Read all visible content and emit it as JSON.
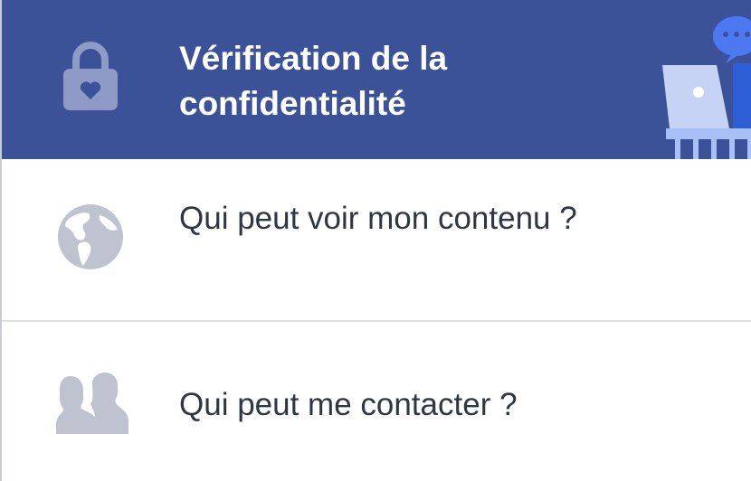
{
  "menu": {
    "header": {
      "title": "Vérification de la confidentialité",
      "icon": "lock-heart-icon",
      "illustration": "laptop-illustration"
    },
    "items": [
      {
        "label": "Qui peut voir mon contenu ?",
        "icon": "globe-icon"
      },
      {
        "label": "Qui peut me contacter ?",
        "icon": "people-icon"
      }
    ]
  },
  "colors": {
    "header_bg": "#3b5198",
    "icon_gray": "#bec3cf",
    "text_dark": "#2f3746",
    "divider": "#dddfe2"
  }
}
